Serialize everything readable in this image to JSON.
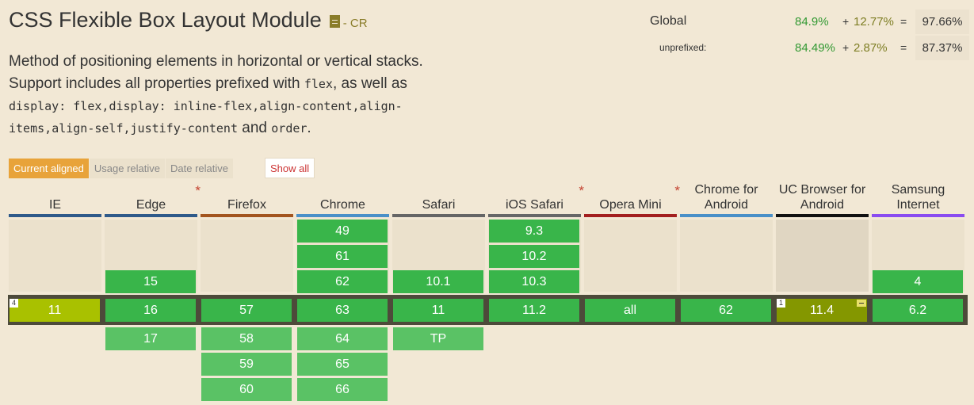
{
  "feature": {
    "title": "CSS Flexible Box Layout Module",
    "doc_icon": "document-icon",
    "status": "- CR"
  },
  "description": {
    "line1": "Method of positioning elements in horizontal or vertical stacks.",
    "line2a": "Support includes all properties prefixed with ",
    "code_flex": "flex",
    "line2b": ", as well as",
    "code1": "display: flex",
    "code2": "display: inline-flex",
    "code3": "align-content",
    "code4a": "align-",
    "code4b": "items",
    "code5": "align-self",
    "code6": "justify-content",
    "and": " and ",
    "code7": "order",
    "period": "."
  },
  "stats": {
    "global": {
      "label": "Global",
      "supported": "84.9%",
      "plus": "+",
      "partial": "12.77%",
      "eq": "=",
      "total": "97.66%"
    },
    "unprefixed": {
      "label": "unprefixed:",
      "supported": "84.49%",
      "plus": "+",
      "partial": "2.87%",
      "eq": "=",
      "total": "87.37%"
    }
  },
  "tabs": {
    "current_aligned": "Current aligned",
    "usage_relative": "Usage relative",
    "date_relative": "Date relative",
    "show_all": "Show all"
  },
  "colors": {
    "supported": "#39b54a",
    "partial": "#a9c100",
    "accent": "#e8a33a",
    "background": "#f2e8d5"
  },
  "browsers": [
    {
      "name": "IE",
      "bar": "#2f5a8a",
      "star": false,
      "past": [],
      "current": "11",
      "current_note": "4",
      "current_type": "partial",
      "future": []
    },
    {
      "name": "Edge",
      "bar": "#2f5a8a",
      "star": true,
      "past": [
        "15"
      ],
      "current": "16",
      "future": [
        "17"
      ]
    },
    {
      "name": "Firefox",
      "bar": "#a3551f",
      "star": false,
      "past": [],
      "current": "57",
      "future": [
        "58",
        "59",
        "60"
      ]
    },
    {
      "name": "Chrome",
      "bar": "#4a90c8",
      "star": false,
      "past": [
        "49",
        "61",
        "62"
      ],
      "current": "63",
      "future": [
        "64",
        "65",
        "66"
      ]
    },
    {
      "name": "Safari",
      "bar": "#666666",
      "star": false,
      "past": [
        "10.1"
      ],
      "current": "11",
      "future": [
        "TP"
      ]
    },
    {
      "name": "iOS Safari",
      "bar": "#666666",
      "star": true,
      "past": [
        "9.3",
        "10.2",
        "10.3"
      ],
      "current": "11.2",
      "future": []
    },
    {
      "name": "Opera Mini",
      "bar": "#a31f1f",
      "star": true,
      "past": [],
      "current": "all",
      "future": []
    },
    {
      "name": "Chrome for Android",
      "bar": "#4a90c8",
      "star": false,
      "past": [],
      "current": "62",
      "future": []
    },
    {
      "name": "UC Browser for Android",
      "bar": "#111111",
      "star": false,
      "past": [],
      "current": "11.4",
      "current_note": "1",
      "current_type": "partial-dark",
      "current_flag": true,
      "future": []
    },
    {
      "name": "Samsung Internet",
      "bar": "#8a4cf0",
      "star": false,
      "past": [
        "4"
      ],
      "current": "6.2",
      "future": []
    }
  ]
}
